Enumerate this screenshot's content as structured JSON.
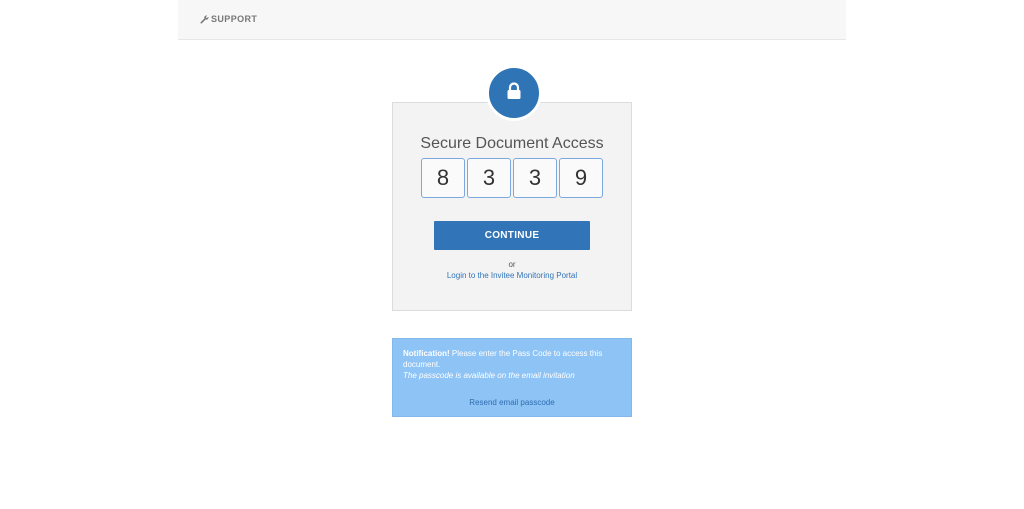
{
  "header": {
    "support_label": "SUPPORT",
    "support_icon": "wrench-icon"
  },
  "access_card": {
    "lock_icon": "lock-icon",
    "title": "Secure Document Access",
    "passcode_digits": [
      "8",
      "3",
      "3",
      "9"
    ],
    "continue_label": "CONTINUE",
    "or_label": "or",
    "portal_link_label": "Login to the Invitee Monitoring Portal"
  },
  "notification": {
    "label": "Notification!",
    "message": " Please enter the Pass Code to access this document.",
    "hint": "The passcode is available on the email invitation",
    "resend_label": "Resend email passcode"
  },
  "colors": {
    "accent": "#3174b7",
    "notification_bg": "#8ec3f5",
    "card_bg": "#f3f3f3"
  }
}
